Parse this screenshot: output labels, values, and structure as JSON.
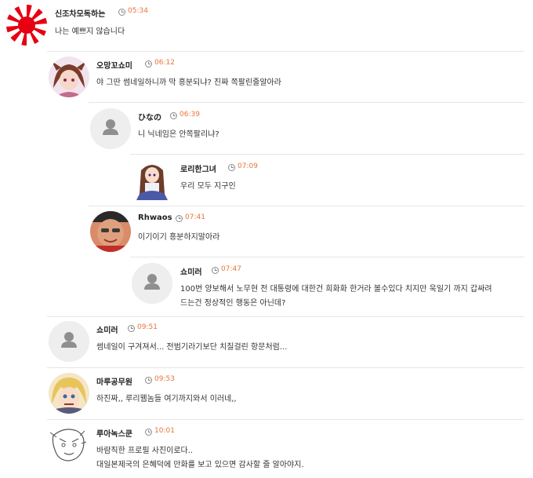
{
  "comments": [
    {
      "nickname": "신조차모독하는",
      "time": "05:34",
      "text": "나는 예쁘지 않습니다",
      "avatar": "rising-sun-avatar"
    },
    {
      "nickname": "오망꼬쇼미",
      "time": "06:12",
      "text": "야 그딴 썸네일하니까 막 흥분되냐? 진짜 쪽팔린줄알아라",
      "avatar": "anime-girl-avatar"
    },
    {
      "nickname": "ひなの",
      "time": "06:39",
      "text": "니 닉네임은 안쪽팔리냐?",
      "avatar": "default-user-avatar"
    },
    {
      "nickname": "로리한그녀",
      "time": "07:09",
      "text": "우리 모두 지구인",
      "avatar": "anime-girl-avatar"
    },
    {
      "nickname": "Rhwaos",
      "time": "07:41",
      "text": "이기이기 흥분하지말아라",
      "avatar": "photo-avatar"
    },
    {
      "nickname": "쇼미러",
      "time": "07:47",
      "text_lines": [
        "100번 양보해서 노무현 전 대통령에 대한건 희화화 한거라 볼수있다 치지만 욱일기 까지 갑싸려",
        "드는건 정상적인 행동은 아닌데?"
      ],
      "avatar": "default-user-avatar"
    },
    {
      "nickname": "쇼미러",
      "time": "09:51",
      "text": "썸네일이 구겨져서... 전범기라기보단 치질걸린 항문처럼...",
      "avatar": "default-user-avatar"
    },
    {
      "nickname": "마루공무원",
      "time": "09:53",
      "text": "하진짜,, 루리웹놈들 여기까지와서 이러네,,",
      "avatar": "anime-blonde-avatar"
    },
    {
      "nickname": "루아녹스쿤",
      "time": "10:01",
      "text_lines": [
        "바람직한 프로필 사진이로다..",
        "대일본제국의 은혜덕에 만화를 보고 있으면 감사할 줄 알아야지."
      ],
      "avatar": "sketch-avatar"
    }
  ],
  "colors": {
    "time": "#e8743b",
    "nickname": "#222222",
    "divider": "#e6e6e6"
  }
}
